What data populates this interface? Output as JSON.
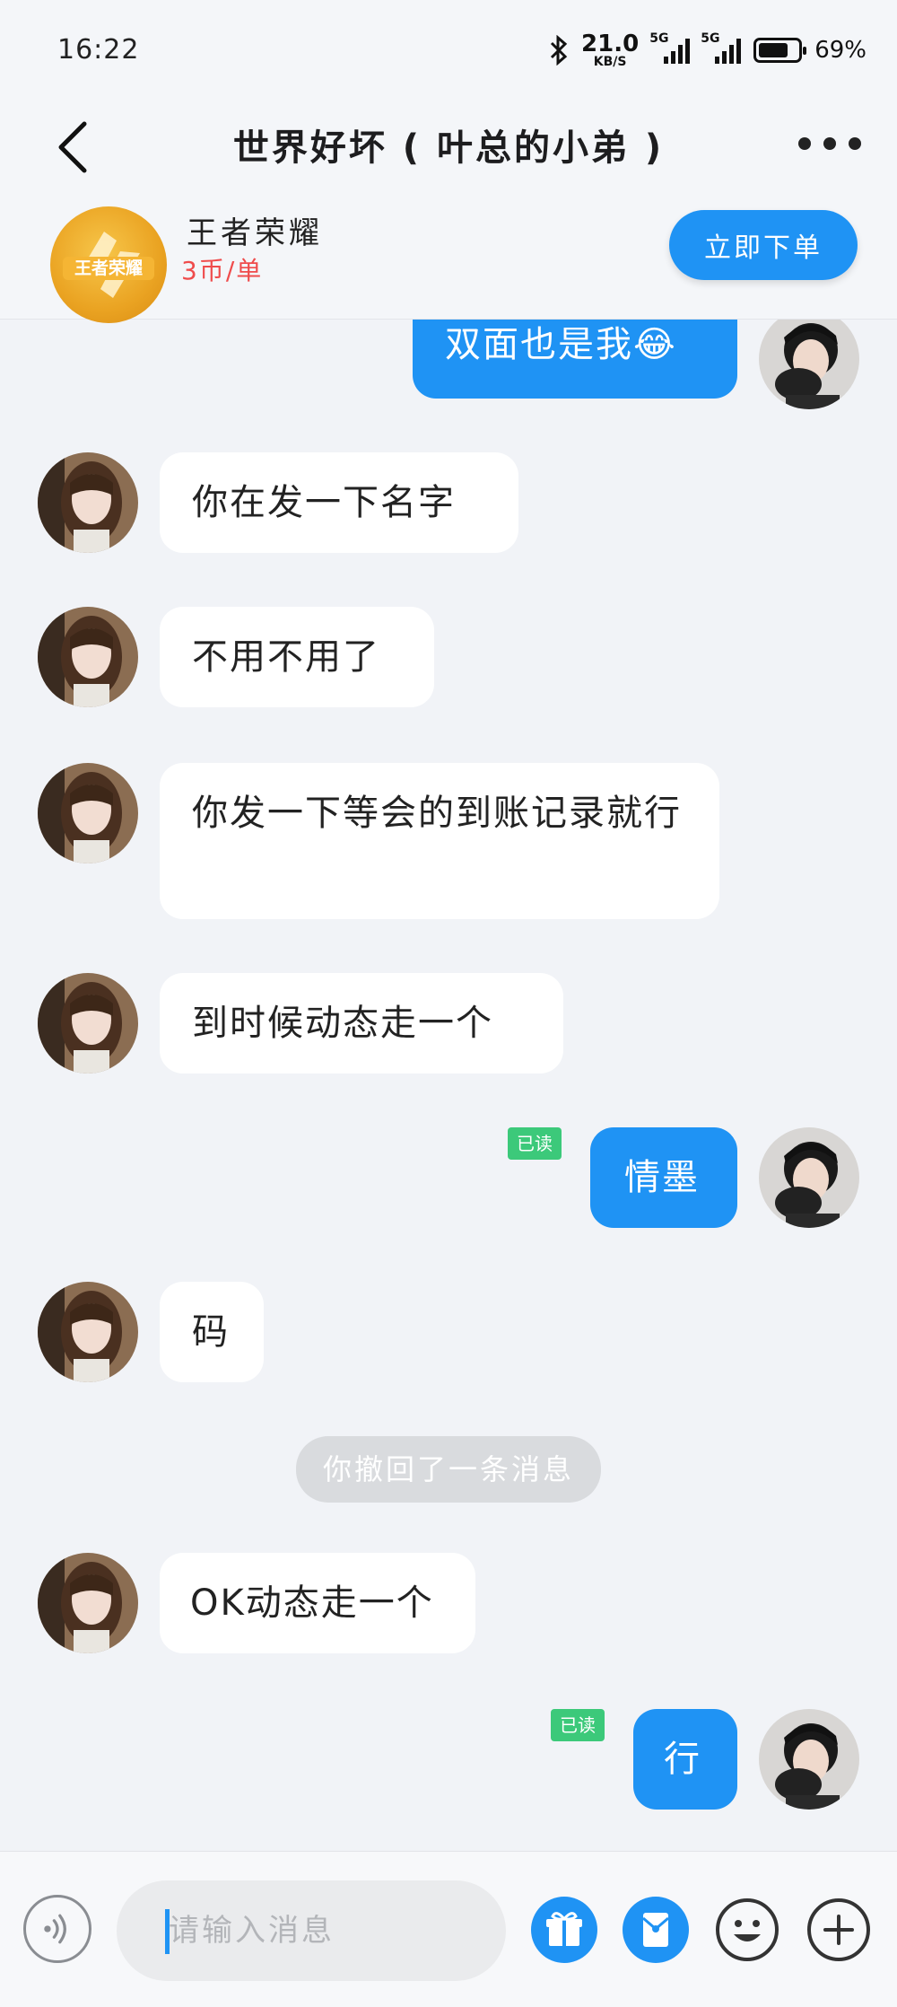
{
  "status_bar": {
    "time": "16:22",
    "net_speed": "21.0",
    "net_unit": "KB/S",
    "signal1_label": "5G",
    "signal2_label": "5G",
    "battery": "69%"
  },
  "nav": {
    "title": "世界好坏 ( 叶总的小弟 )"
  },
  "banner": {
    "game_name": "王者荣耀",
    "price": "3币/单",
    "order_button": "立即下单"
  },
  "messages": [
    {
      "dir": "out",
      "text": "双面也是我😂",
      "read": ""
    },
    {
      "dir": "in",
      "text": "你在发一下名字"
    },
    {
      "dir": "in",
      "text": "不用不用了"
    },
    {
      "dir": "in",
      "text": "你发一下等会的到账记录就行"
    },
    {
      "dir": "in",
      "text": "到时候动态走一个"
    },
    {
      "dir": "out",
      "text": "情墨",
      "read": "已读"
    },
    {
      "dir": "in",
      "text": "码"
    },
    {
      "dir": "system",
      "text": "你撤回了一条消息"
    },
    {
      "dir": "in",
      "text": "OK动态走一个"
    },
    {
      "dir": "out",
      "text": "行",
      "read": "已读"
    }
  ],
  "input": {
    "placeholder": "请输入消息"
  },
  "colors": {
    "accent": "#1f93f4",
    "read_badge": "#3cc97a",
    "price": "#ef4c4c",
    "background": "#f1f3f7"
  },
  "icons": [
    "back-arrow-icon",
    "more-dots-icon",
    "voice-icon",
    "gift-icon",
    "red-packet-icon",
    "emoji-icon",
    "plus-icon"
  ]
}
